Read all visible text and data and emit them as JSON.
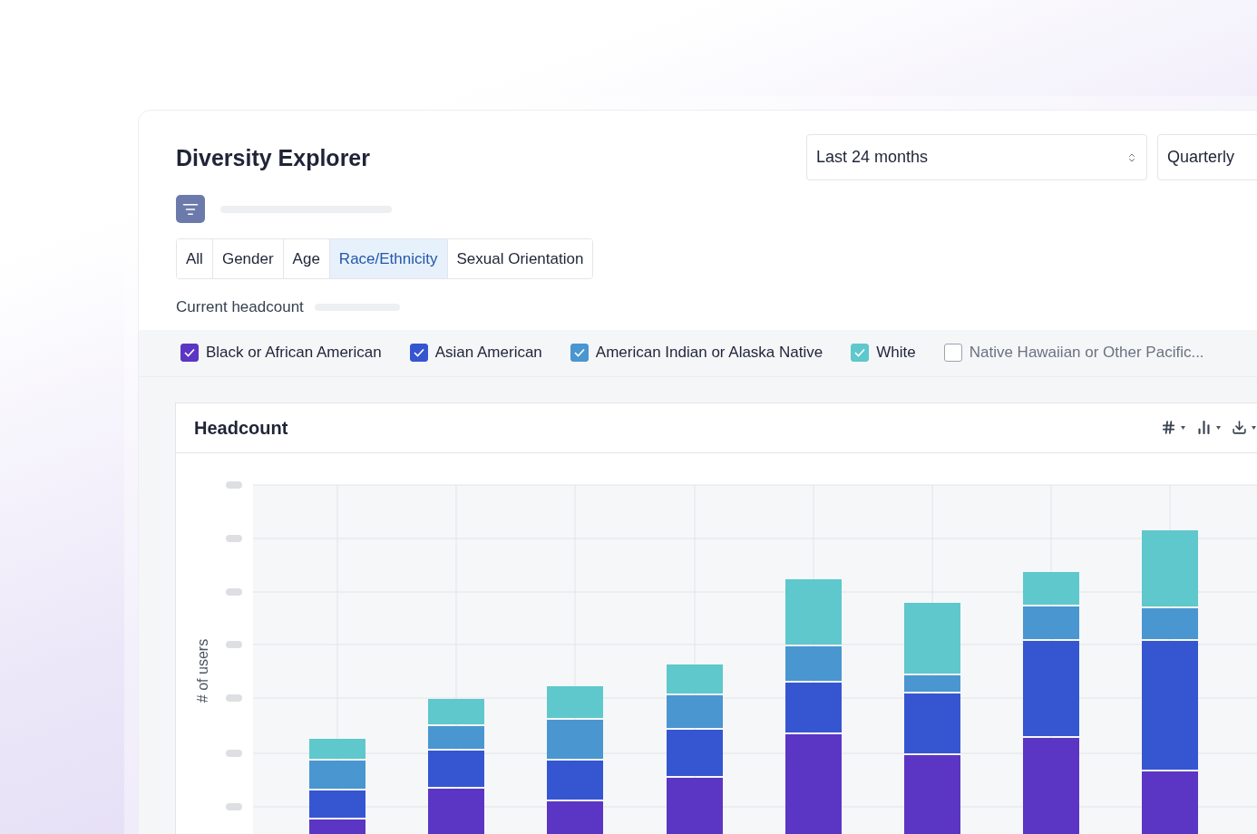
{
  "title": "Diversity Explorer",
  "period_select": {
    "value": "Last 24 months"
  },
  "interval_select": {
    "value": "Quarterly"
  },
  "tabs": [
    {
      "label": "All",
      "selected": false
    },
    {
      "label": "Gender",
      "selected": false
    },
    {
      "label": "Age",
      "selected": false
    },
    {
      "label": "Race/Ethnicity",
      "selected": true
    },
    {
      "label": "Sexual Orientation",
      "selected": false
    }
  ],
  "headcount_label": "Current headcount",
  "legend": [
    {
      "label": "Black or African American",
      "checked": true,
      "color": "#5b36c4"
    },
    {
      "label": "Asian American",
      "checked": true,
      "color": "#3656d1"
    },
    {
      "label": "American Indian or Alaska Native",
      "checked": true,
      "color": "#4a96d0"
    },
    {
      "label": "White",
      "checked": true,
      "color": "#5ec8cc"
    },
    {
      "label": "Native Hawaiian or Other Pacific...",
      "checked": false
    }
  ],
  "chart_panel": {
    "title": "Headcount",
    "ylabel": "# of users"
  }
}
